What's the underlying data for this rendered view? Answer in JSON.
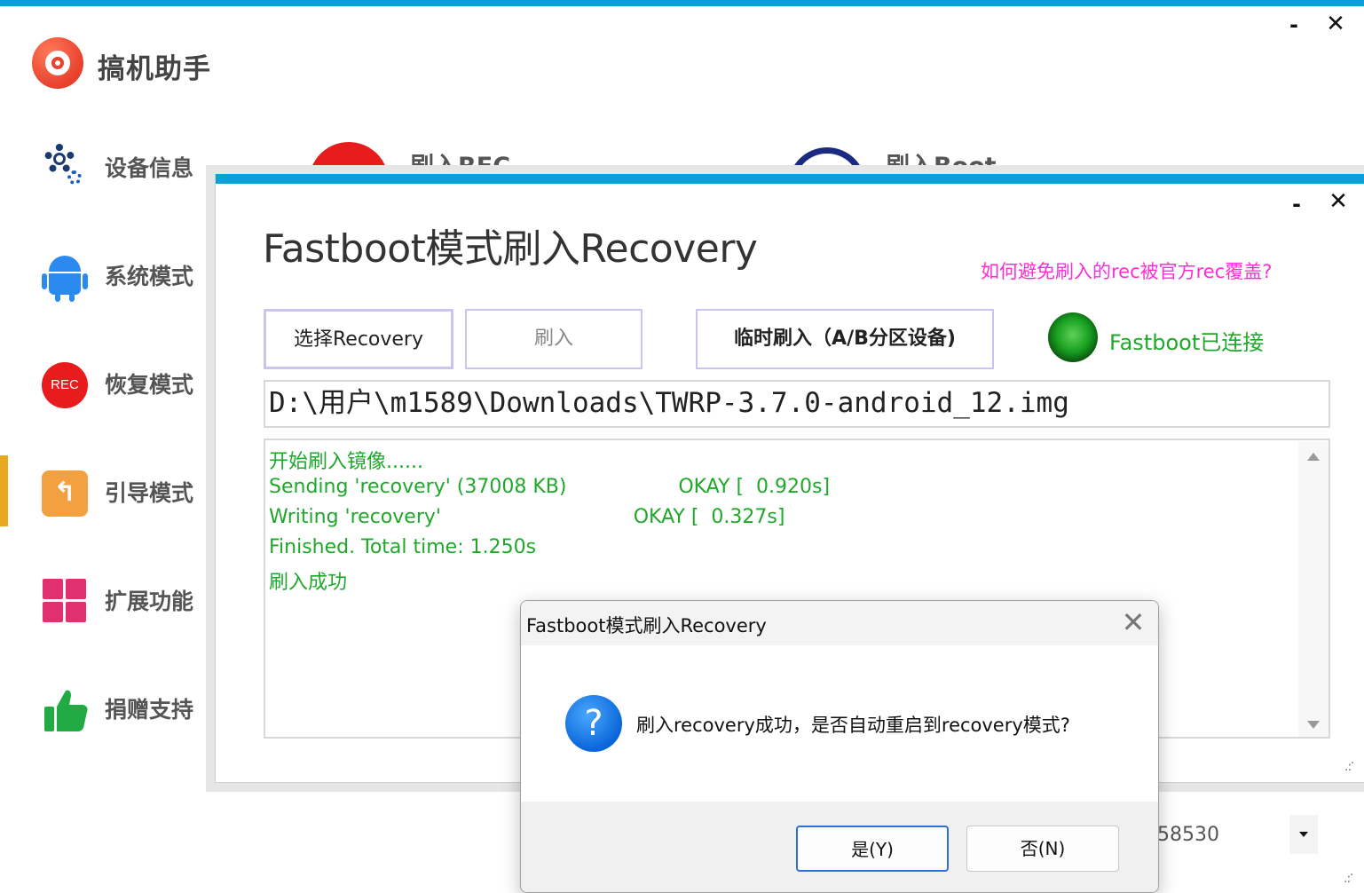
{
  "app": {
    "title": "搞机助手",
    "minimize": "-",
    "close": "✕"
  },
  "sidebar": {
    "items": [
      {
        "label": "设备信息",
        "icon": "gear-icon"
      },
      {
        "label": "系统模式",
        "icon": "android-icon"
      },
      {
        "label": "恢复模式",
        "icon": "rec-icon",
        "icon_text": "REC"
      },
      {
        "label": "引导模式",
        "icon": "boot-icon",
        "icon_text": "↰"
      },
      {
        "label": "扩展功能",
        "icon": "grid-icon"
      },
      {
        "label": "捐赠支持",
        "icon": "thumbs-up-icon"
      }
    ],
    "active_index": 3
  },
  "main_panel": {
    "rec_label": "刷入REC",
    "boot_label": "刷入Boot",
    "device_value": "58530"
  },
  "flash_dialog": {
    "title": "Fastboot模式刷入Recovery",
    "minimize": "-",
    "close": "✕",
    "help_link": "如何避免刷入的rec被官方rec覆盖?",
    "buttons": {
      "select": "选择Recovery",
      "flash": "刷入",
      "temp_flash": "临时刷入（A/B分区设备)"
    },
    "status": "Fastboot已连接",
    "path": "D:\\用户\\m1589\\Downloads\\TWRP-3.7.0-android_12.img",
    "log": [
      "开始刷入镜像......",
      "Sending 'recovery' (37008 KB)                  OKAY [  0.920s]",
      "Writing 'recovery'                               OKAY [  0.327s]",
      "Finished. Total time: 1.250s",
      "刷入成功"
    ]
  },
  "message_box": {
    "title": "Fastboot模式刷入Recovery",
    "close": "✕",
    "icon_text": "?",
    "text": "刷入recovery成功，是否自动重启到recovery模式?",
    "yes": "是(Y)",
    "no": "否(N)"
  },
  "colors": {
    "accent_bar": "#0aa0d8",
    "active_indicator": "#e9a820",
    "log_text": "#1fa82a",
    "help_link": "#ff2ed4",
    "status_connected": "#1fa82a"
  }
}
